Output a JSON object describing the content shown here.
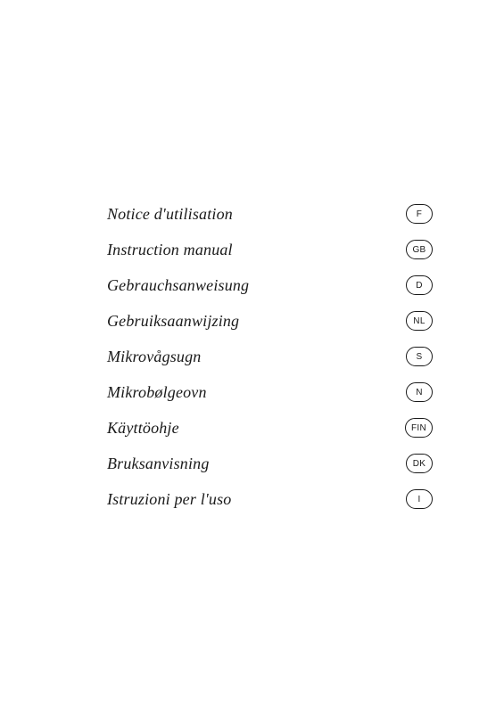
{
  "menu": {
    "items": [
      {
        "label": "Notice d'utilisation",
        "badge": "F"
      },
      {
        "label": "Instruction manual",
        "badge": "GB"
      },
      {
        "label": "Gebrauchsanweisung",
        "badge": "D"
      },
      {
        "label": "Gebruiksaanwijzing",
        "badge": "NL"
      },
      {
        "label": "Mikrovågsugn",
        "badge": "S"
      },
      {
        "label": "Mikrobølgeovn",
        "badge": "N"
      },
      {
        "label": "Käyttöohje",
        "badge": "FIN"
      },
      {
        "label": "Bruksanvisning",
        "badge": "DK"
      },
      {
        "label": "Istruzioni per l'uso",
        "badge": "I"
      }
    ]
  }
}
